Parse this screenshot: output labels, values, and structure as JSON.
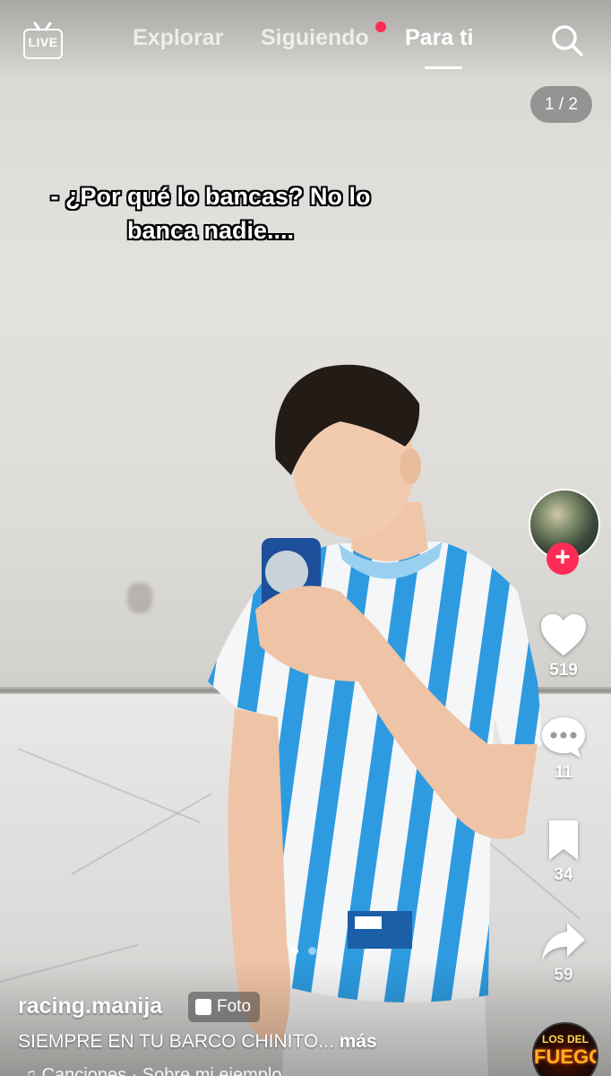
{
  "header": {
    "live_label": "LIVE",
    "tabs": [
      {
        "label": "Explorar",
        "active": false
      },
      {
        "label": "Siguiendo",
        "active": false,
        "has_notification_dot": true
      },
      {
        "label": "Para ti",
        "active": true
      }
    ]
  },
  "image_counter": "1 / 2",
  "overlay_caption": "- ¿Por qué lo bancas? No lo banca nadie....",
  "actions": {
    "likes": "519",
    "comments": "11",
    "saves": "34",
    "shares": "59"
  },
  "pager": {
    "current": 1,
    "total": 2
  },
  "post": {
    "username": "racing.manija",
    "type_badge": "Foto",
    "description": "SIEMPRE EN TU BARCO CHINITO...",
    "more_label": "más",
    "music": "Canciones · Sobre mi ejemplo"
  },
  "music_disc": {
    "line1": "LOS DEL",
    "line2": "FUEGO"
  },
  "colors": {
    "accent": "#fe2c55",
    "jersey_blue": "#2e9be0"
  },
  "icons": [
    "live-icon",
    "search-icon",
    "heart-icon",
    "comment-icon",
    "bookmark-icon",
    "share-icon",
    "photo-icon",
    "music-note-icon"
  ]
}
